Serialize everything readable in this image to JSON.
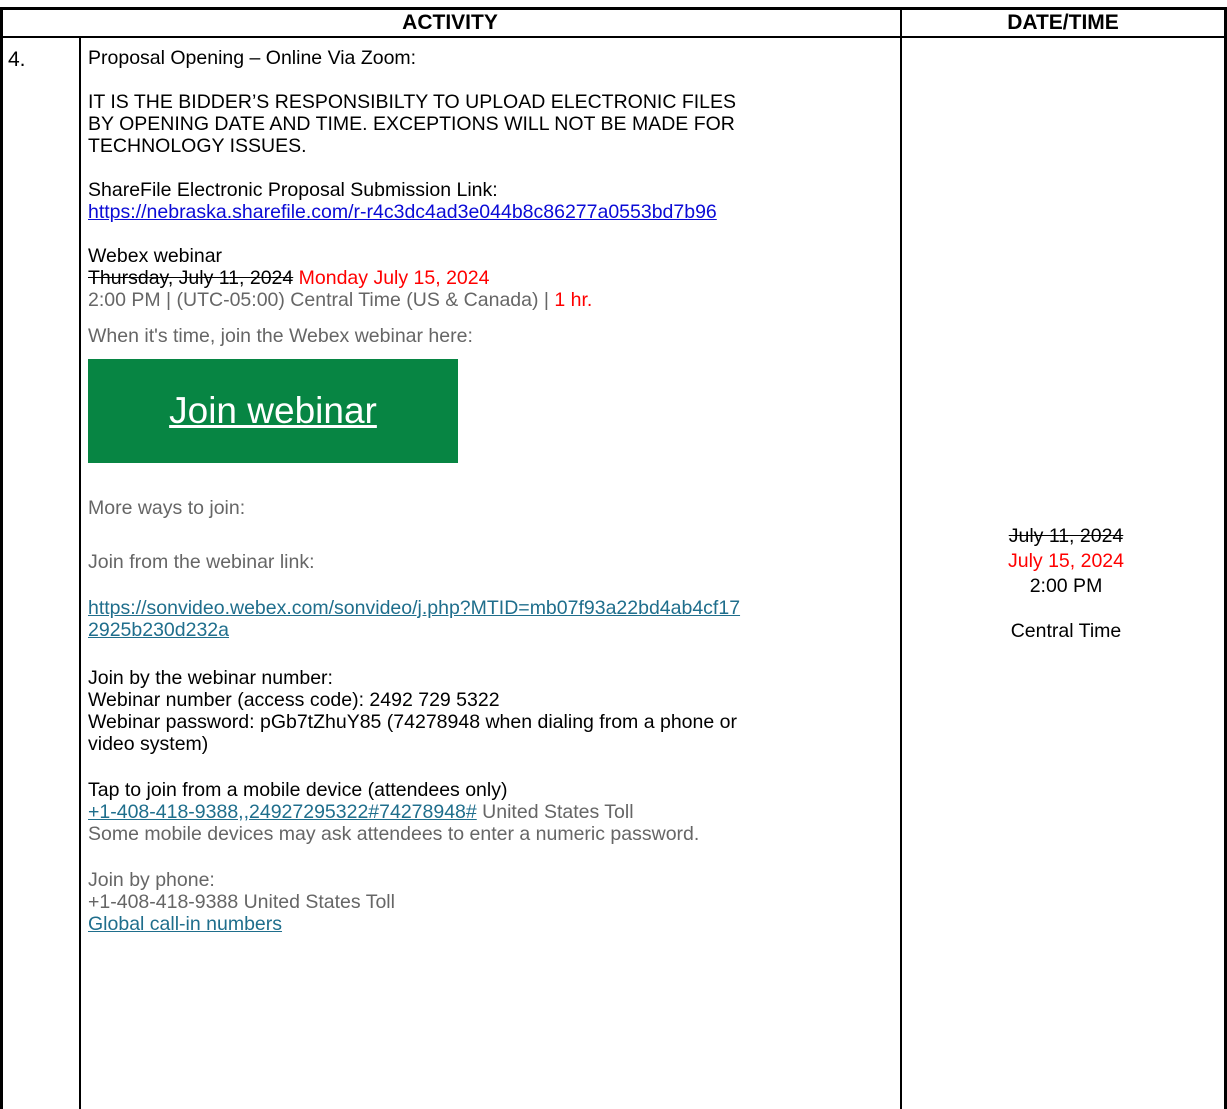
{
  "header": {
    "activity": "ACTIVITY",
    "datetime": "DATE/TIME"
  },
  "row": {
    "number": "4.",
    "title": "Proposal Opening – Online Via Zoom:",
    "warning_lines": [
      "IT IS THE BIDDER’S RESPONSIBILTY TO UPLOAD ELECTRONIC FILES",
      "BY OPENING DATE AND TIME. EXCEPTIONS WILL NOT BE MADE FOR",
      "TECHNOLOGY ISSUES."
    ],
    "sharefile_label": "ShareFile Electronic Proposal Submission Link:",
    "sharefile_url": "https://nebraska.sharefile.com/r-r4c3dc4ad3e044b8c86277a0553bd7b96",
    "webex_title": "Webex webinar",
    "old_date": "Thursday, July 11, 2024",
    "new_date": "Monday July 15, 2024",
    "time_line": "2:00 PM | (UTC-05:00) Central Time (US & Canada) | ",
    "duration": "1 hr.",
    "join_prompt": "When it's time, join the Webex webinar here:",
    "join_button": "Join webinar",
    "more_ways": "More ways to join:",
    "join_from_link": "Join from the webinar link:",
    "webinar_url_line1": "https://sonvideo.webex.com/sonvideo/j.php?MTID=mb07f93a22bd4ab4cf17",
    "webinar_url_line2": "2925b230d232a",
    "join_by_number": "Join by the webinar number:",
    "webinar_number": "Webinar number (access code): 2492 729 5322",
    "webinar_password_line1": "Webinar password: pGb7tZhuY85 (74278948 when dialing from a phone or",
    "webinar_password_line2": "video system)",
    "tap_to_join": "Tap to join from a mobile device (attendees only)",
    "mobile_link": "+1-408-418-9388,,24927295322#74278948#",
    "mobile_toll": " United States Toll",
    "mobile_note": "Some mobile devices may ask attendees to enter a numeric password.",
    "join_by_phone": "Join by phone:",
    "phone_number": "+1-408-418-9388 United States Toll",
    "global_numbers": "Global call-in numbers"
  },
  "datetime_cell": {
    "old_date": "July 11, 2024",
    "new_date": "July 15, 2024",
    "time": "2:00 PM",
    "zone": "Central Time"
  }
}
